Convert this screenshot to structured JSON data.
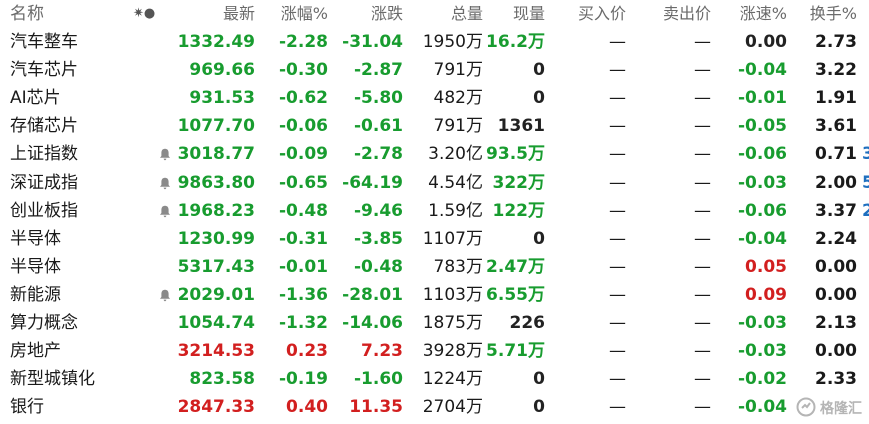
{
  "header": {
    "name": "名称",
    "star": "✷●",
    "price": "最新",
    "change_pct": "涨幅%",
    "change": "涨跌",
    "volume": "总量",
    "current_volume": "现量",
    "bid": "买入价",
    "ask": "卖出价",
    "speed": "涨速%",
    "turnover": "换手%"
  },
  "colors": {
    "up": "#d21f1f",
    "down": "#189c2f",
    "extra": "#1e6fbf"
  },
  "rows": [
    {
      "name": "汽车整车",
      "price": "1332.49",
      "pct": "-2.28",
      "chg": "-31.04",
      "vol": "1950万",
      "cur": "16.2万",
      "cur_color": "down",
      "bid": "—",
      "ask": "—",
      "spd": "0.00",
      "spd_color": "flat",
      "turn": "2.73",
      "dir": "down",
      "bell": false,
      "extra": ""
    },
    {
      "name": "汽车芯片",
      "price": "969.66",
      "pct": "-0.30",
      "chg": "-2.87",
      "vol": "791万",
      "cur": "0",
      "cur_color": "flat",
      "bid": "—",
      "ask": "—",
      "spd": "-0.04",
      "spd_color": "down",
      "turn": "3.22",
      "dir": "down",
      "bell": false,
      "extra": ""
    },
    {
      "name": "AI芯片",
      "price": "931.53",
      "pct": "-0.62",
      "chg": "-5.80",
      "vol": "482万",
      "cur": "0",
      "cur_color": "flat",
      "bid": "—",
      "ask": "—",
      "spd": "-0.01",
      "spd_color": "down",
      "turn": "1.91",
      "dir": "down",
      "bell": false,
      "extra": ""
    },
    {
      "name": "存储芯片",
      "price": "1077.70",
      "pct": "-0.06",
      "chg": "-0.61",
      "vol": "791万",
      "cur": "1361",
      "cur_color": "flat",
      "bid": "—",
      "ask": "—",
      "spd": "-0.05",
      "spd_color": "down",
      "turn": "3.61",
      "dir": "down",
      "bell": false,
      "extra": ""
    },
    {
      "name": "上证指数",
      "price": "3018.77",
      "pct": "-0.09",
      "chg": "-2.78",
      "vol": "3.20亿",
      "cur": "93.5万",
      "cur_color": "down",
      "bid": "—",
      "ask": "—",
      "spd": "-0.06",
      "spd_color": "down",
      "turn": "0.71",
      "dir": "down",
      "bell": true,
      "extra": "3"
    },
    {
      "name": "深证成指",
      "price": "9863.80",
      "pct": "-0.65",
      "chg": "-64.19",
      "vol": "4.54亿",
      "cur": "322万",
      "cur_color": "down",
      "bid": "—",
      "ask": "—",
      "spd": "-0.03",
      "spd_color": "down",
      "turn": "2.00",
      "dir": "down",
      "bell": true,
      "extra": "5"
    },
    {
      "name": "创业板指",
      "price": "1968.23",
      "pct": "-0.48",
      "chg": "-9.46",
      "vol": "1.59亿",
      "cur": "122万",
      "cur_color": "down",
      "bid": "—",
      "ask": "—",
      "spd": "-0.06",
      "spd_color": "down",
      "turn": "3.37",
      "dir": "down",
      "bell": true,
      "extra": "2"
    },
    {
      "name": "半导体",
      "price": "1230.99",
      "pct": "-0.31",
      "chg": "-3.85",
      "vol": "1107万",
      "cur": "0",
      "cur_color": "flat",
      "bid": "—",
      "ask": "—",
      "spd": "-0.04",
      "spd_color": "down",
      "turn": "2.24",
      "dir": "down",
      "bell": false,
      "extra": ""
    },
    {
      "name": "半导体",
      "price": "5317.43",
      "pct": "-0.01",
      "chg": "-0.48",
      "vol": "783万",
      "cur": "2.47万",
      "cur_color": "down",
      "bid": "—",
      "ask": "—",
      "spd": "0.05",
      "spd_color": "up",
      "turn": "0.00",
      "dir": "down",
      "bell": false,
      "extra": ""
    },
    {
      "name": "新能源",
      "price": "2029.01",
      "pct": "-1.36",
      "chg": "-28.01",
      "vol": "1103万",
      "cur": "6.55万",
      "cur_color": "down",
      "bid": "—",
      "ask": "—",
      "spd": "0.09",
      "spd_color": "up",
      "turn": "0.00",
      "dir": "down",
      "bell": true,
      "extra": ""
    },
    {
      "name": "算力概念",
      "price": "1054.74",
      "pct": "-1.32",
      "chg": "-14.06",
      "vol": "1875万",
      "cur": "226",
      "cur_color": "flat",
      "bid": "—",
      "ask": "—",
      "spd": "-0.03",
      "spd_color": "down",
      "turn": "2.13",
      "dir": "down",
      "bell": false,
      "extra": ""
    },
    {
      "name": "房地产",
      "price": "3214.53",
      "pct": "0.23",
      "chg": "7.23",
      "vol": "3928万",
      "cur": "5.71万",
      "cur_color": "down",
      "bid": "—",
      "ask": "—",
      "spd": "-0.03",
      "spd_color": "down",
      "turn": "0.00",
      "dir": "up",
      "bell": false,
      "extra": ""
    },
    {
      "name": "新型城镇化",
      "price": "823.58",
      "pct": "-0.19",
      "chg": "-1.60",
      "vol": "1224万",
      "cur": "0",
      "cur_color": "flat",
      "bid": "—",
      "ask": "—",
      "spd": "-0.02",
      "spd_color": "down",
      "turn": "2.33",
      "dir": "down",
      "bell": false,
      "extra": ""
    },
    {
      "name": "银行",
      "price": "2847.33",
      "pct": "0.40",
      "chg": "11.35",
      "vol": "2704万",
      "cur": "0",
      "cur_color": "flat",
      "bid": "—",
      "ask": "—",
      "spd": "-0.04",
      "spd_color": "down",
      "turn": "",
      "dir": "up",
      "bell": false,
      "extra": ""
    }
  ],
  "watermark": {
    "text": "格隆汇",
    "icon": "watermark-logo-icon"
  }
}
